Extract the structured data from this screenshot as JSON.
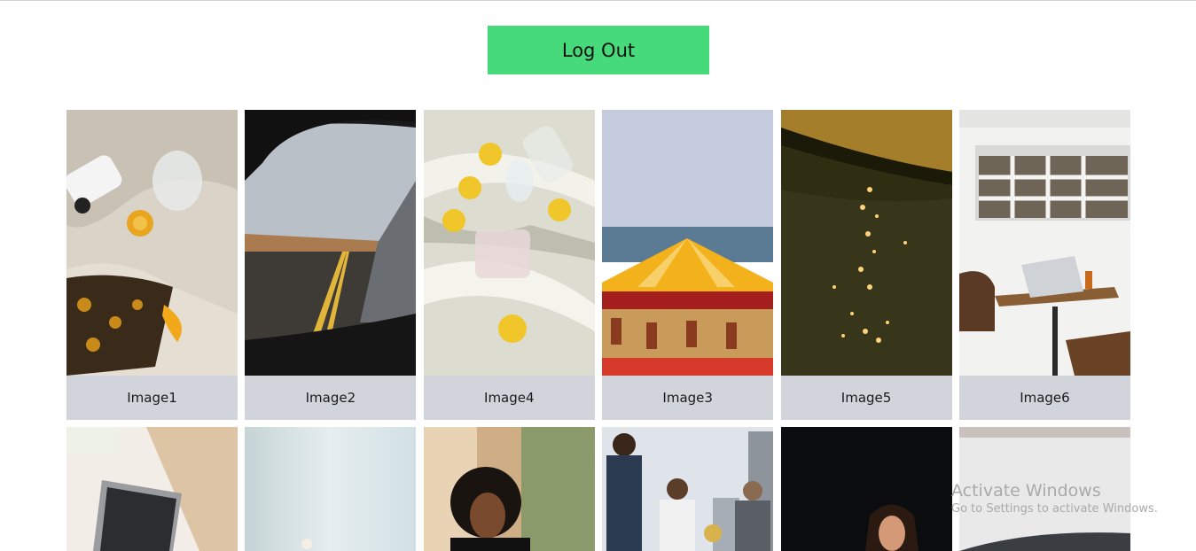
{
  "header": {
    "logout_label": "Log Out"
  },
  "gallery": {
    "row1": [
      {
        "caption": "Image1"
      },
      {
        "caption": "Image2"
      },
      {
        "caption": "Image4"
      },
      {
        "caption": "Image3"
      },
      {
        "caption": "Image5"
      },
      {
        "caption": "Image6"
      }
    ]
  },
  "watermark": {
    "title": "Activate Windows",
    "subtitle": "Go to Settings to activate Windows."
  }
}
